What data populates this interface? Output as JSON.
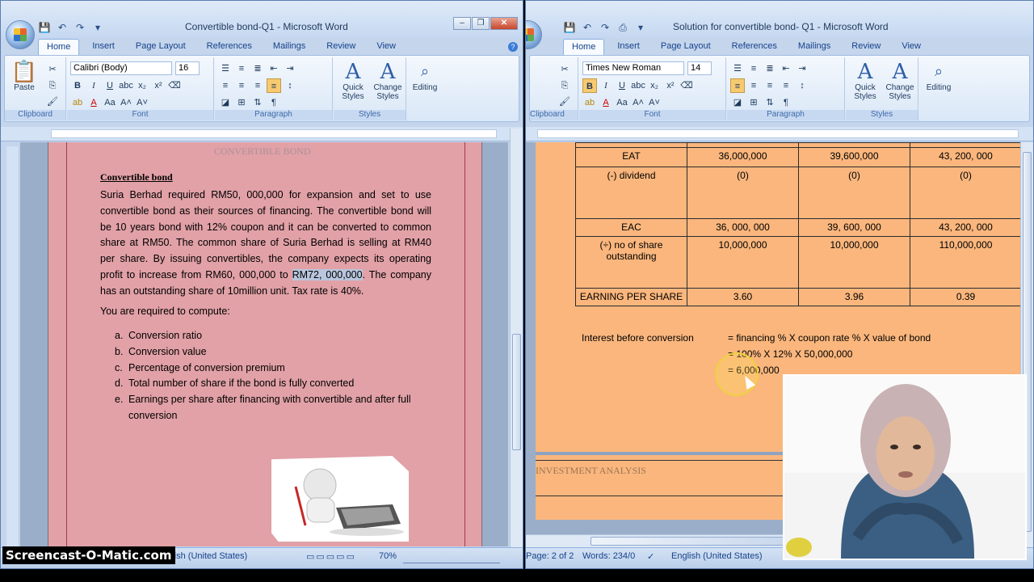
{
  "left_window": {
    "title": "Convertible bond-Q1 - Microsoft Word",
    "tabs": [
      "Home",
      "Insert",
      "Page Layout",
      "References",
      "Mailings",
      "Review",
      "View"
    ],
    "font_name": "Calibri (Body)",
    "font_size": "16",
    "groups": {
      "clipboard": "Clipboard",
      "font": "Font",
      "paragraph": "Paragraph",
      "styles": "Styles"
    },
    "buttons": {
      "paste": "Paste",
      "quick_styles": "Quick Styles",
      "change_styles": "Change Styles",
      "editing": "Editing"
    },
    "doc": {
      "faded_header": "CONVERTIBLE BOND",
      "heading": "Convertible bond",
      "para_a": "Suria Berhad required RM50, 000,000 for expansion and set to use convertible bond as their sources of financing. The convertible bond will be 10 years bond with 12% coupon and it can be converted to common share at RM50. The common share of Suria Berhad is selling at RM40 per share. By issuing convertibles, the company expects its operating profit to increase from RM60, 000,000 to ",
      "para_highlight": "RM72, 000,000",
      "para_b": ". The company has an outstanding share of 10million unit. Tax rate is 40%.",
      "required": "You are required to compute:",
      "questions": [
        {
          "letter": "a.",
          "text": "Conversion ratio"
        },
        {
          "letter": "b.",
          "text": "Conversion value"
        },
        {
          "letter": "c.",
          "text": "Percentage of conversion premium"
        },
        {
          "letter": "d.",
          "text": "Total number of share if the bond is fully converted"
        },
        {
          "letter": "e.",
          "text": "Earnings per share after financing with convertible and after full conversion"
        }
      ]
    },
    "status": {
      "language": "nglish (United States)",
      "zoom": "70%"
    }
  },
  "right_window": {
    "title": "Solution for convertible bond- Q1 - Microsoft Word",
    "tabs": [
      "Home",
      "Insert",
      "Page Layout",
      "References",
      "Mailings",
      "Review",
      "View"
    ],
    "font_name": "Times New Roman",
    "font_size": "14",
    "groups": {
      "clipboard": "Clipboard",
      "font": "Font",
      "paragraph": "Paragraph",
      "styles": "Styles"
    },
    "buttons": {
      "quick_styles": "Quick Styles",
      "change_styles": "Change Styles",
      "editing": "Editing"
    },
    "table": [
      [
        "EAT",
        "36,000,000",
        "39,600,000",
        "43, 200, 000"
      ],
      [
        "(-) dividend",
        "(0)",
        "(0)",
        "(0)"
      ],
      [
        "EAC",
        "36, 000, 000",
        "39, 600, 000",
        "43, 200, 000"
      ],
      [
        "(÷) no of share outstanding",
        "10,000,000",
        "10,000,000",
        "110,000,000"
      ],
      [
        "EARNING PER SHARE",
        "3.60",
        "3.96",
        "0.39"
      ]
    ],
    "calc": {
      "label": "Interest before conversion",
      "line1": "= financing % X coupon rate % X value of bond",
      "line2": "= 100% X 12% X 50,000,000",
      "line3": "= 6,000,000"
    },
    "section_heading": "INVESTMENT ANALYSIS",
    "status": {
      "page": "Page: 2 of 2",
      "words": "Words: 234/0",
      "language": "English (United States)"
    }
  },
  "watermark": "Screencast-O-Matic.com",
  "colors": {
    "left_page": "#e1a1a7",
    "right_page": "#fab67d",
    "ribbon": "#d9e7f7"
  }
}
